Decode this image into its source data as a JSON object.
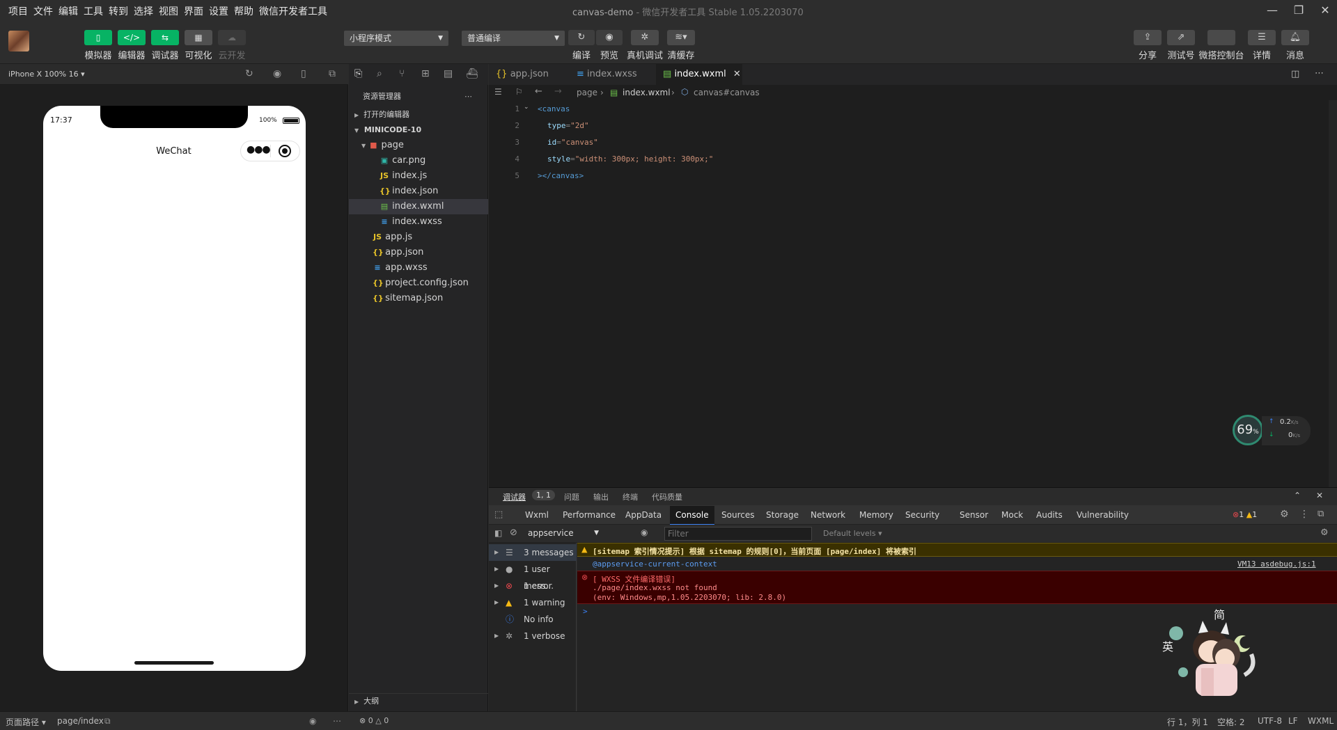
{
  "menubar": {
    "items": [
      "项目",
      "文件",
      "编辑",
      "工具",
      "转到",
      "选择",
      "视图",
      "界面",
      "设置",
      "帮助",
      "微信开发者工具"
    ],
    "window_title": "canvas-demo",
    "window_subtitle": "- 微信开发者工具 Stable 1.05.2203070"
  },
  "toolbar": {
    "buttons": [
      {
        "label": "模拟器",
        "icon": "phone-icon"
      },
      {
        "label": "编辑器",
        "icon": "code-icon"
      },
      {
        "label": "调试器",
        "icon": "debug-icon"
      },
      {
        "label": "可视化",
        "icon": "layout-icon"
      },
      {
        "label": "云开发",
        "icon": "cloud-icon"
      }
    ],
    "mode_select": "小程序模式",
    "compile_select": "普通编译",
    "center_actions": [
      "编译",
      "预览",
      "真机调试",
      "清缓存"
    ],
    "right_actions": [
      "分享",
      "测试号",
      "微搭控制台",
      "详情",
      "消息"
    ]
  },
  "simulator": {
    "device_label": "iPhone X 100% 16",
    "time": "17:37",
    "battery": "100%",
    "nav_title": "WeChat"
  },
  "explorer": {
    "title": "资源管理器",
    "open_editors": "打开的编辑器",
    "project": "MINICODE-10",
    "outline": "大纲",
    "files": [
      {
        "name": "page",
        "type": "folder"
      },
      {
        "name": "car.png",
        "type": "image"
      },
      {
        "name": "index.js",
        "type": "js"
      },
      {
        "name": "index.json",
        "type": "json"
      },
      {
        "name": "index.wxml",
        "type": "wxml"
      },
      {
        "name": "index.wxss",
        "type": "wxss"
      },
      {
        "name": "app.js",
        "type": "js"
      },
      {
        "name": "app.json",
        "type": "json"
      },
      {
        "name": "app.wxss",
        "type": "wxss"
      },
      {
        "name": "project.config.json",
        "type": "json"
      },
      {
        "name": "sitemap.json",
        "type": "json"
      }
    ]
  },
  "editor": {
    "tabs": [
      "app.json",
      "index.wxss",
      "index.wxml"
    ],
    "breadcrumb": [
      "page",
      "index.wxml",
      "canvas#canvas"
    ],
    "lines": [
      {
        "num": "1",
        "code": "<canvas"
      },
      {
        "num": "2",
        "attr": "type",
        "val": "\"2d\""
      },
      {
        "num": "3",
        "attr": "id",
        "val": "\"canvas\""
      },
      {
        "num": "4",
        "attr": "style",
        "val": "\"width: 300px; height: 300px;\""
      },
      {
        "num": "5",
        "code": "></canvas>"
      }
    ]
  },
  "perf": {
    "value": "69",
    "unit": "%",
    "up": "0.2",
    "down": "0",
    "rate_unit": "K/s"
  },
  "debugger": {
    "tabs": [
      "调试器",
      "1, 1",
      "问题",
      "输出",
      "终端",
      "代码质量"
    ],
    "devtools_tabs": [
      "Wxml",
      "Performance",
      "AppData",
      "Console",
      "Sources",
      "Storage",
      "Network",
      "Memory",
      "Security",
      "Sensor",
      "Mock",
      "Audits",
      "Vulnerability"
    ],
    "error_count": "1",
    "warning_count": "1",
    "context": "appservice",
    "filter_placeholder": "Filter",
    "levels": "Default levels",
    "sidebar": [
      "3 messages",
      "1 user mess...",
      "1 error",
      "1 warning",
      "No info",
      "1 verbose"
    ],
    "warning_msg": "[sitemap 索引情况提示] 根据 sitemap 的规则[0]，当前页面 [page/index] 将被索引",
    "context_msg": "@appservice-current-context",
    "source_link": "VM13 asdebug.js:1",
    "error_title": "[ WXSS 文件编译错误]",
    "error_line1": "./page/index.wxss not found",
    "error_line2": "(env: Windows,mp,1.05.2203070; lib: 2.8.0)",
    "prompt": ">"
  },
  "statusbar": {
    "path_label": "页面路径",
    "path": "page/index",
    "problems_errors": "0",
    "problems_warnings": "0",
    "position": "行 1，列 1",
    "spaces": "空格: 2",
    "encoding": "UTF-8",
    "eol": "LF",
    "language": "WXML"
  },
  "colors": {
    "accent_green": "#07b364",
    "error_red": "#e5484d",
    "warning_yellow": "#f5b914",
    "link_blue": "#3c82f6"
  }
}
